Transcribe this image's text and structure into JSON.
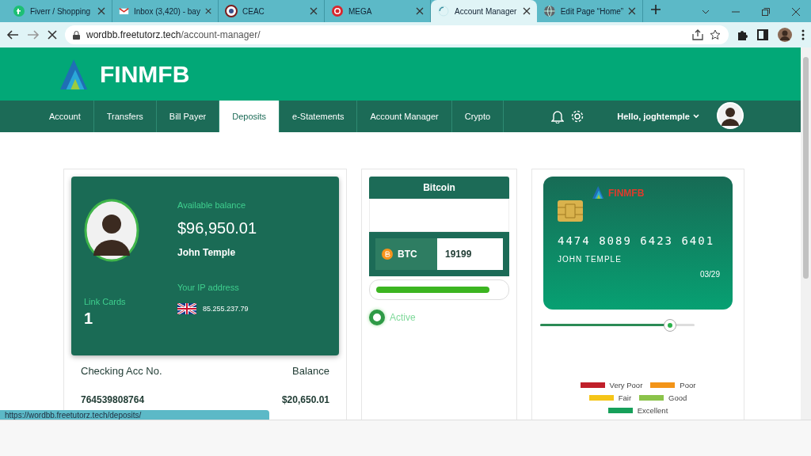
{
  "browser": {
    "tabs": [
      {
        "title": "Fiverr / Shopping",
        "selected": false
      },
      {
        "title": "Inbox (3,420) - bay",
        "selected": false
      },
      {
        "title": "CEAC",
        "selected": false
      },
      {
        "title": "MEGA",
        "selected": false
      },
      {
        "title": "Account Manager",
        "selected": true
      },
      {
        "title": "Edit Page “Home”",
        "selected": false
      }
    ],
    "url_domain": "wordbb.freetutorz.tech",
    "url_path": "/account-manager/",
    "loading": true
  },
  "site": {
    "logo": "FINMFB",
    "nav": [
      {
        "label": "Account",
        "selected": false
      },
      {
        "label": "Transfers",
        "selected": false
      },
      {
        "label": "Bill Payer",
        "selected": false
      },
      {
        "label": "Deposits",
        "selected": true
      },
      {
        "label": "e-Statements",
        "selected": false
      },
      {
        "label": "Account Manager",
        "selected": false
      },
      {
        "label": "Crypto",
        "selected": false
      }
    ],
    "greeting": "Hello, joghtemple"
  },
  "account_card": {
    "available_label": "Available balance",
    "balance": "$96,950.01",
    "name": "John Temple",
    "link_cards_label": "Link Cards",
    "link_cards": "1",
    "ip_label": "Your IP address",
    "ip": "85.255.237.79",
    "columns": [
      "Checking Acc No.",
      "Balance"
    ],
    "rows": [
      [
        "764539808764",
        "$20,650.01"
      ]
    ]
  },
  "crypto": {
    "title": "Bitcoin",
    "symbol": "BTC",
    "value": "19199",
    "level": 0.9,
    "status": "Active",
    "active": true
  },
  "bank_card": {
    "logo": "FINMFB",
    "number": "4474 8089 6423 6401",
    "holder": "JOHN TEMPLE",
    "expiry": "03/29",
    "level": 0.84,
    "legend": [
      {
        "label": "Very Poor",
        "color": "#c0202a"
      },
      {
        "label": "Poor",
        "color": "#f39418"
      },
      {
        "label": "Fair",
        "color": "#f5c518"
      },
      {
        "label": "Good",
        "color": "#8bc34a"
      },
      {
        "label": "Excellent",
        "color": "#17a05a"
      }
    ]
  },
  "status_url": "https://wordbb.freetutorz.tech/deposits/"
}
